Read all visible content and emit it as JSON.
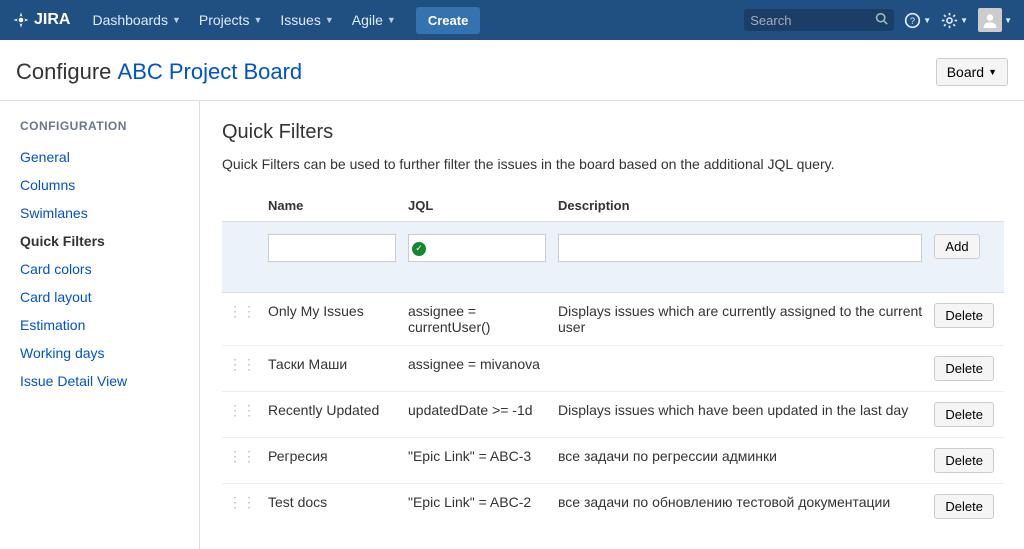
{
  "nav": {
    "logo_text": "JIRA",
    "items": [
      "Dashboards",
      "Projects",
      "Issues",
      "Agile"
    ],
    "create": "Create",
    "search_placeholder": "Search"
  },
  "page": {
    "title_prefix": "Configure ",
    "board_name": "ABC Project Board",
    "board_button": "Board"
  },
  "sidebar": {
    "heading": "CONFIGURATION",
    "items": [
      {
        "label": "General",
        "active": false
      },
      {
        "label": "Columns",
        "active": false
      },
      {
        "label": "Swimlanes",
        "active": false
      },
      {
        "label": "Quick Filters",
        "active": true
      },
      {
        "label": "Card colors",
        "active": false
      },
      {
        "label": "Card layout",
        "active": false
      },
      {
        "label": "Estimation",
        "active": false
      },
      {
        "label": "Working days",
        "active": false
      },
      {
        "label": "Issue Detail View",
        "active": false
      }
    ]
  },
  "content": {
    "heading": "Quick Filters",
    "description": "Quick Filters can be used to further filter the issues in the board based on the additional JQL query.",
    "columns": {
      "name": "Name",
      "jql": "JQL",
      "description": "Description"
    },
    "add_button": "Add",
    "delete_button": "Delete",
    "rows": [
      {
        "name": "Only My Issues",
        "jql": "assignee = currentUser()",
        "description": "Displays issues which are currently assigned to the current user"
      },
      {
        "name": "Таски Маши",
        "jql": "assignee = mivanova",
        "description": ""
      },
      {
        "name": "Recently Updated",
        "jql": "updatedDate >= -1d",
        "description": "Displays issues which have been updated in the last day"
      },
      {
        "name": "Регресия",
        "jql": "\"Epic Link\" = ABC-3",
        "description": "все задачи по регрессии админки"
      },
      {
        "name": "Test docs",
        "jql": "\"Epic Link\" = ABC-2",
        "description": "все задачи по обновлению тестовой документации"
      }
    ]
  }
}
